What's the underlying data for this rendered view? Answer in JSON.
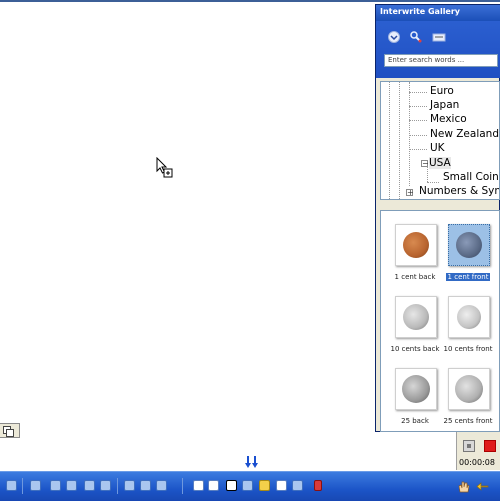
{
  "gallery": {
    "title": "Interwrite Gallery",
    "search_placeholder": "Enter search words ...",
    "tree": [
      {
        "label": "Euro"
      },
      {
        "label": "Japan"
      },
      {
        "label": "Mexico"
      },
      {
        "label": "New Zealand"
      },
      {
        "label": "UK"
      },
      {
        "label": "USA",
        "expanded": true,
        "selected": true
      },
      {
        "label": "Small Coins"
      },
      {
        "label": "Numbers & Symbols"
      }
    ],
    "thumbnails": [
      {
        "caption": "1 cent back",
        "coin_color": "#b8642f",
        "selected": false
      },
      {
        "caption": "1 cent front",
        "coin_color": "#5a6a86",
        "selected": true
      },
      {
        "caption": "10 cents back",
        "coin_color": "#b9b9b9",
        "selected": false
      },
      {
        "caption": "10 cents front",
        "coin_color": "#c4c4c4",
        "selected": false
      },
      {
        "caption": "25 back",
        "coin_color": "#9a9a9a",
        "selected": false
      },
      {
        "caption": "25 cents front",
        "coin_color": "#b0b0b0",
        "selected": false
      }
    ]
  },
  "recorder": {
    "time": "00:00:08"
  },
  "colors": {
    "taskbar": "#1c55c8",
    "titlebar": "#1b4fb8",
    "selection": "#316ac5",
    "record": "#e01b1b"
  }
}
